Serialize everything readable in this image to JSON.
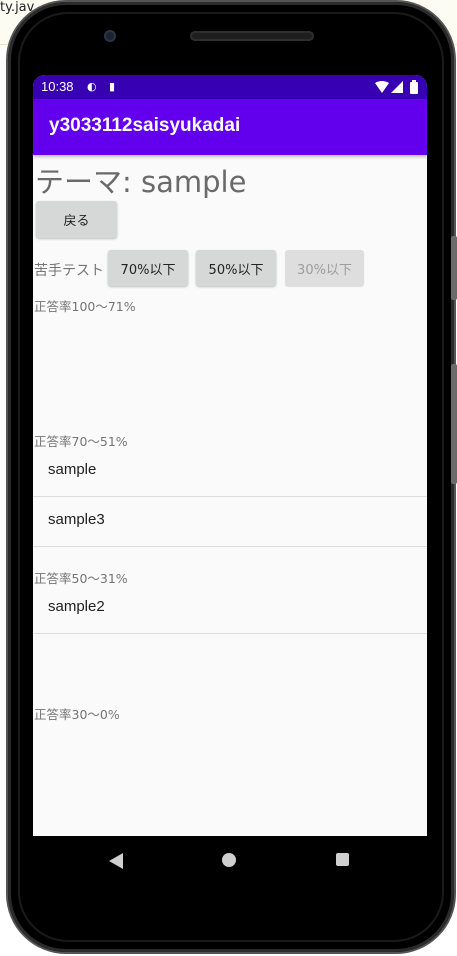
{
  "ide": {
    "tab_text": "ty.jav"
  },
  "status_bar": {
    "time": "10:38"
  },
  "app_bar": {
    "title": "y3033112saisyukadai"
  },
  "theme": {
    "title": "テーマ:  sample"
  },
  "buttons": {
    "back": "戻る",
    "btn70": "70%以下",
    "btn50": "50%以下",
    "btn30": "30%以下"
  },
  "weak_test_label": "苦手テスト",
  "sections": [
    {
      "label": "正答率100〜71%",
      "items": []
    },
    {
      "label": "正答率70〜51%",
      "items": [
        "sample",
        "sample3"
      ]
    },
    {
      "label": "正答率50〜31%",
      "items": [
        "sample2"
      ]
    },
    {
      "label": "正答率30〜0%",
      "items": []
    }
  ],
  "colors": {
    "status_bar": "#3700b3",
    "app_bar": "#6200ee",
    "screen_bg": "#fafafa"
  }
}
